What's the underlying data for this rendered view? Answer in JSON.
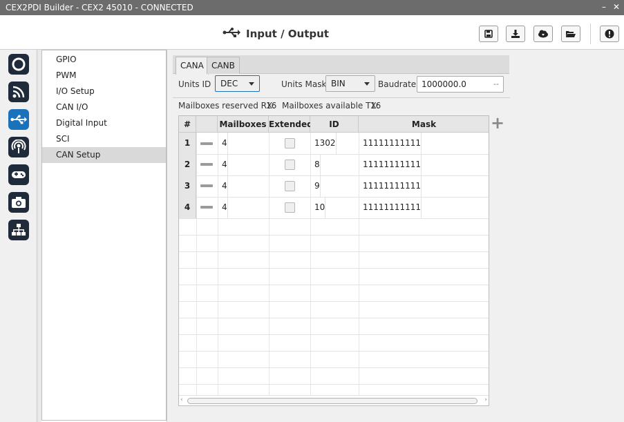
{
  "window": {
    "title": "CEX2PDI Builder - CEX2 45010 - CONNECTED",
    "min_glyph": "–",
    "close_glyph": "✕"
  },
  "header": {
    "title": "Input / Output",
    "buttons": [
      {
        "icon": "save-icon"
      },
      {
        "icon": "download-icon"
      },
      {
        "icon": "cloud-download-icon"
      },
      {
        "icon": "folder-open-icon"
      },
      {
        "icon": "info-icon"
      }
    ]
  },
  "iconbar": {
    "items": [
      {
        "icon": "power-ring-icon"
      },
      {
        "icon": "rss-feed-icon"
      },
      {
        "icon": "usb-icon",
        "active": true
      },
      {
        "icon": "podcast-icon"
      },
      {
        "icon": "gamepad-icon"
      },
      {
        "icon": "camera-icon"
      },
      {
        "icon": "sitemap-icon"
      }
    ],
    "accent": "#1a72ba"
  },
  "menu": {
    "items": [
      {
        "label": "GPIO"
      },
      {
        "label": "PWM"
      },
      {
        "label": "I/O Setup"
      },
      {
        "label": "CAN I/O"
      },
      {
        "label": "Digital Input"
      },
      {
        "label": "SCI"
      },
      {
        "label": "CAN Setup",
        "active": true
      }
    ]
  },
  "tabs": [
    {
      "label": "CANA",
      "active": true
    },
    {
      "label": "CANB"
    }
  ],
  "controls": {
    "units_id_label": "Units ID",
    "units_id_value": "DEC",
    "units_mask_label": "Units Mask",
    "units_mask_value": "BIN",
    "baudrate_label": "Baudrate",
    "baudrate_value": "1000000.0",
    "baudrate_unit": "--"
  },
  "info": {
    "rx_label": "Mailboxes reserved RX:",
    "rx_value": "16",
    "tx_label": "Mailboxes available TX:",
    "tx_value": "16"
  },
  "table": {
    "columns": [
      "#",
      "",
      "Mailboxes",
      "Extended",
      "ID",
      "Mask"
    ],
    "rows": [
      {
        "num": "1",
        "mailboxes": "4",
        "extended": false,
        "id": "1302",
        "mask": "11111111111"
      },
      {
        "num": "2",
        "mailboxes": "4",
        "extended": false,
        "id": "8",
        "mask": "11111111111"
      },
      {
        "num": "3",
        "mailboxes": "4",
        "extended": false,
        "id": "9",
        "mask": "11111111111"
      },
      {
        "num": "4",
        "mailboxes": "4",
        "extended": false,
        "id": "10",
        "mask": "11111111111"
      }
    ],
    "add_glyph": "+"
  }
}
